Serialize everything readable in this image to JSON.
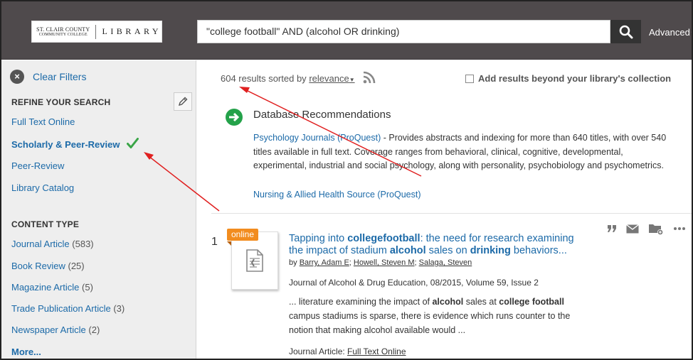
{
  "header": {
    "logo_line1": "ST. CLAIR COUNTY",
    "logo_line2": "COMMUNITY COLLEGE",
    "logo_library": "LIBRARY",
    "search_query": "\"college football\" AND (alcohol OR drinking)",
    "advanced_label": "Advanced"
  },
  "sidebar": {
    "clear_filters": "Clear Filters",
    "refine_title": "REFINE YOUR SEARCH",
    "refine_items": [
      {
        "label": "Full Text Online"
      },
      {
        "label": "Scholarly & Peer-Review"
      },
      {
        "label": "Peer-Review"
      },
      {
        "label": "Library Catalog"
      }
    ],
    "content_type_title": "CONTENT TYPE",
    "content_types": [
      {
        "label": "Journal Article",
        "count": "(583)"
      },
      {
        "label": "Book Review",
        "count": "(25)"
      },
      {
        "label": "Magazine Article",
        "count": "(5)"
      },
      {
        "label": "Trade Publication Article",
        "count": "(3)"
      },
      {
        "label": "Newspaper Article",
        "count": "(2)"
      }
    ],
    "more": "More..."
  },
  "results": {
    "count_text": "604 results sorted by",
    "sort_label": "relevance",
    "beyond_label": "Add results beyond your library's collection"
  },
  "recommendations": {
    "title": "Database Recommendations",
    "item1_link": "Psychology Journals (ProQuest)",
    "item1_desc": " - Provides abstracts and indexing for more than 640 titles, with over 540 titles available in full text. Coverage ranges from behavioral, clinical, cognitive, developmental, experimental, industrial and social psychology, along with personality, psychobiology and psychometrics.",
    "item2_link": "Nursing & Allied Health Source (ProQuest)"
  },
  "result1": {
    "number": "1",
    "badge": "online",
    "title_p1": "Tapping into ",
    "title_b1": "collegefootball",
    "title_p2": ": the need for research examining the impact of stadium ",
    "title_b2": "alcohol",
    "title_p3": " sales on ",
    "title_b3": "drinking",
    "title_p4": " behaviors...",
    "by": "by ",
    "author1": "Barry, Adam E",
    "sep1": "; ",
    "author2": "Howell, Steven M",
    "sep2": "; ",
    "author3": "Salaga, Steven",
    "source": "Journal of Alcohol & Drug Education, 08/2015, Volume 59, Issue 2",
    "snip_p1": "... literature examining the impact of ",
    "snip_b1": "alcohol",
    "snip_p2": " sales at ",
    "snip_b2": "college football",
    "snip_p3": " campus stadiums is sparse, there is evidence which runs counter to the notion that making alcohol available would ...",
    "format_label": "Journal Article: ",
    "format_link": "Full Text Online"
  },
  "colors": {
    "link": "#1c6aa8",
    "header_bg": "#4f4a4c",
    "online_badge": "#f28c1f",
    "check_green": "#3aa547",
    "annotation_arrow": "#e02020"
  }
}
